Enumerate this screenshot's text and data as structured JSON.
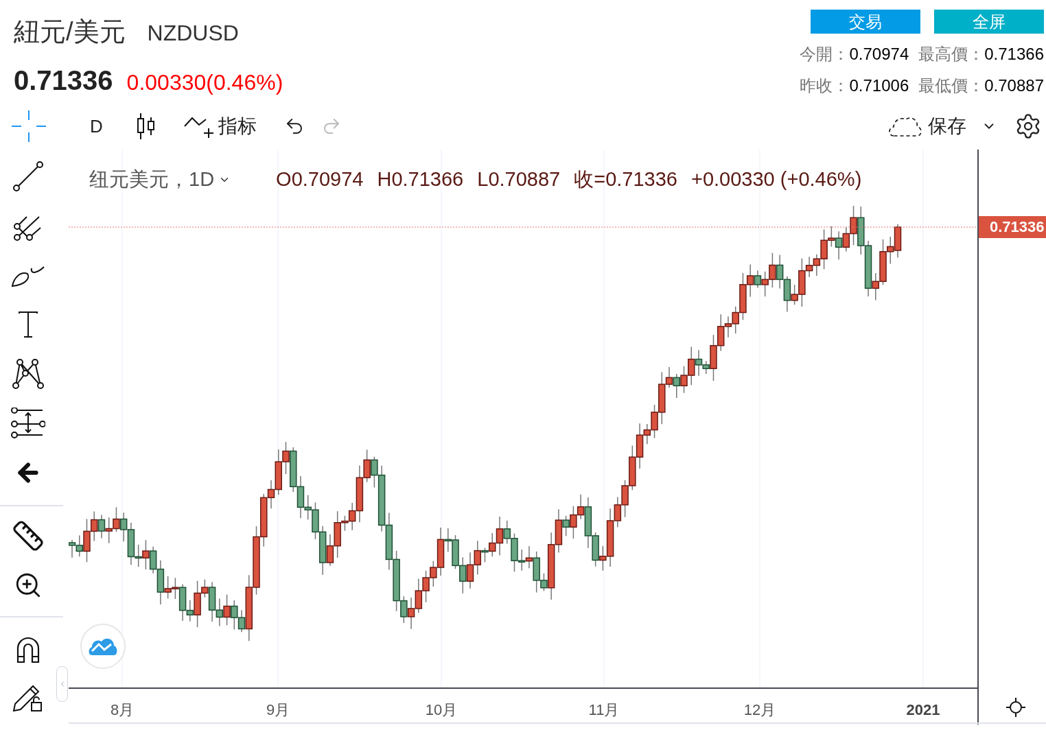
{
  "header": {
    "name": "紐元/美元",
    "symbol": "NZDUSD",
    "price": "0.71336",
    "change": "0.00330(0.46%)"
  },
  "buttons": [
    {
      "label": "交易",
      "kind": "trade"
    },
    {
      "label": "全屏",
      "kind": "fullscreen"
    }
  ],
  "stats": [
    [
      {
        "label": "今開：",
        "value": "0.70974"
      },
      {
        "label": "最高價：",
        "value": "0.71366"
      }
    ],
    [
      {
        "label": "昨收：",
        "value": "0.71006"
      },
      {
        "label": "最低價：",
        "value": "0.70887"
      }
    ]
  ],
  "toolbar": {
    "crosshair_selected": true,
    "interval": "D",
    "indicators": "指标",
    "redo_disabled": true,
    "save": "保存"
  },
  "legend": {
    "title": "纽元美元，1D",
    "open": "O0.70974",
    "high": "H0.71366",
    "low": "L0.70887",
    "close": "收=0.71336",
    "change": "+0.00330 (+0.46%)"
  },
  "price_label": "0.71336",
  "time_axis": [
    {
      "label": "8月",
      "bold": false
    },
    {
      "label": "9月",
      "bold": false
    },
    {
      "label": "10月",
      "bold": false
    },
    {
      "label": "11月",
      "bold": false
    },
    {
      "label": "12月",
      "bold": false
    },
    {
      "label": "2021",
      "bold": true
    }
  ]
}
